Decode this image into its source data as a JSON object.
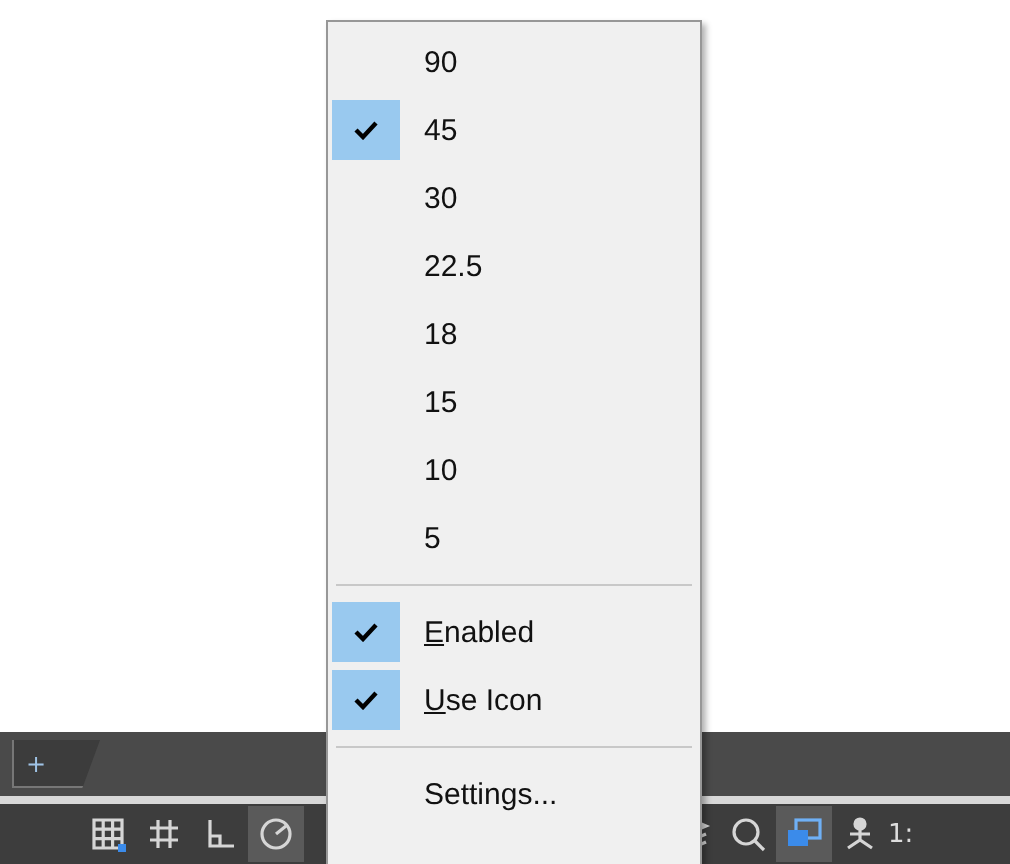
{
  "tab_bar": {
    "new_tab_label": "+"
  },
  "status_bar": {
    "scale_text": "1:"
  },
  "menu": {
    "items": [
      {
        "kind": "option",
        "label": "90",
        "checked": false
      },
      {
        "kind": "option",
        "label": "45",
        "checked": true
      },
      {
        "kind": "option",
        "label": "30",
        "checked": false
      },
      {
        "kind": "option",
        "label": "22.5",
        "checked": false
      },
      {
        "kind": "option",
        "label": "18",
        "checked": false
      },
      {
        "kind": "option",
        "label": "15",
        "checked": false
      },
      {
        "kind": "option",
        "label": "10",
        "checked": false
      },
      {
        "kind": "option",
        "label": "5",
        "checked": false
      },
      {
        "kind": "separator"
      },
      {
        "kind": "toggle",
        "label": "Enabled",
        "checked": true
      },
      {
        "kind": "toggle",
        "label": "Use Icon",
        "checked": true
      },
      {
        "kind": "separator"
      },
      {
        "kind": "command",
        "label": "Settings..."
      }
    ]
  }
}
